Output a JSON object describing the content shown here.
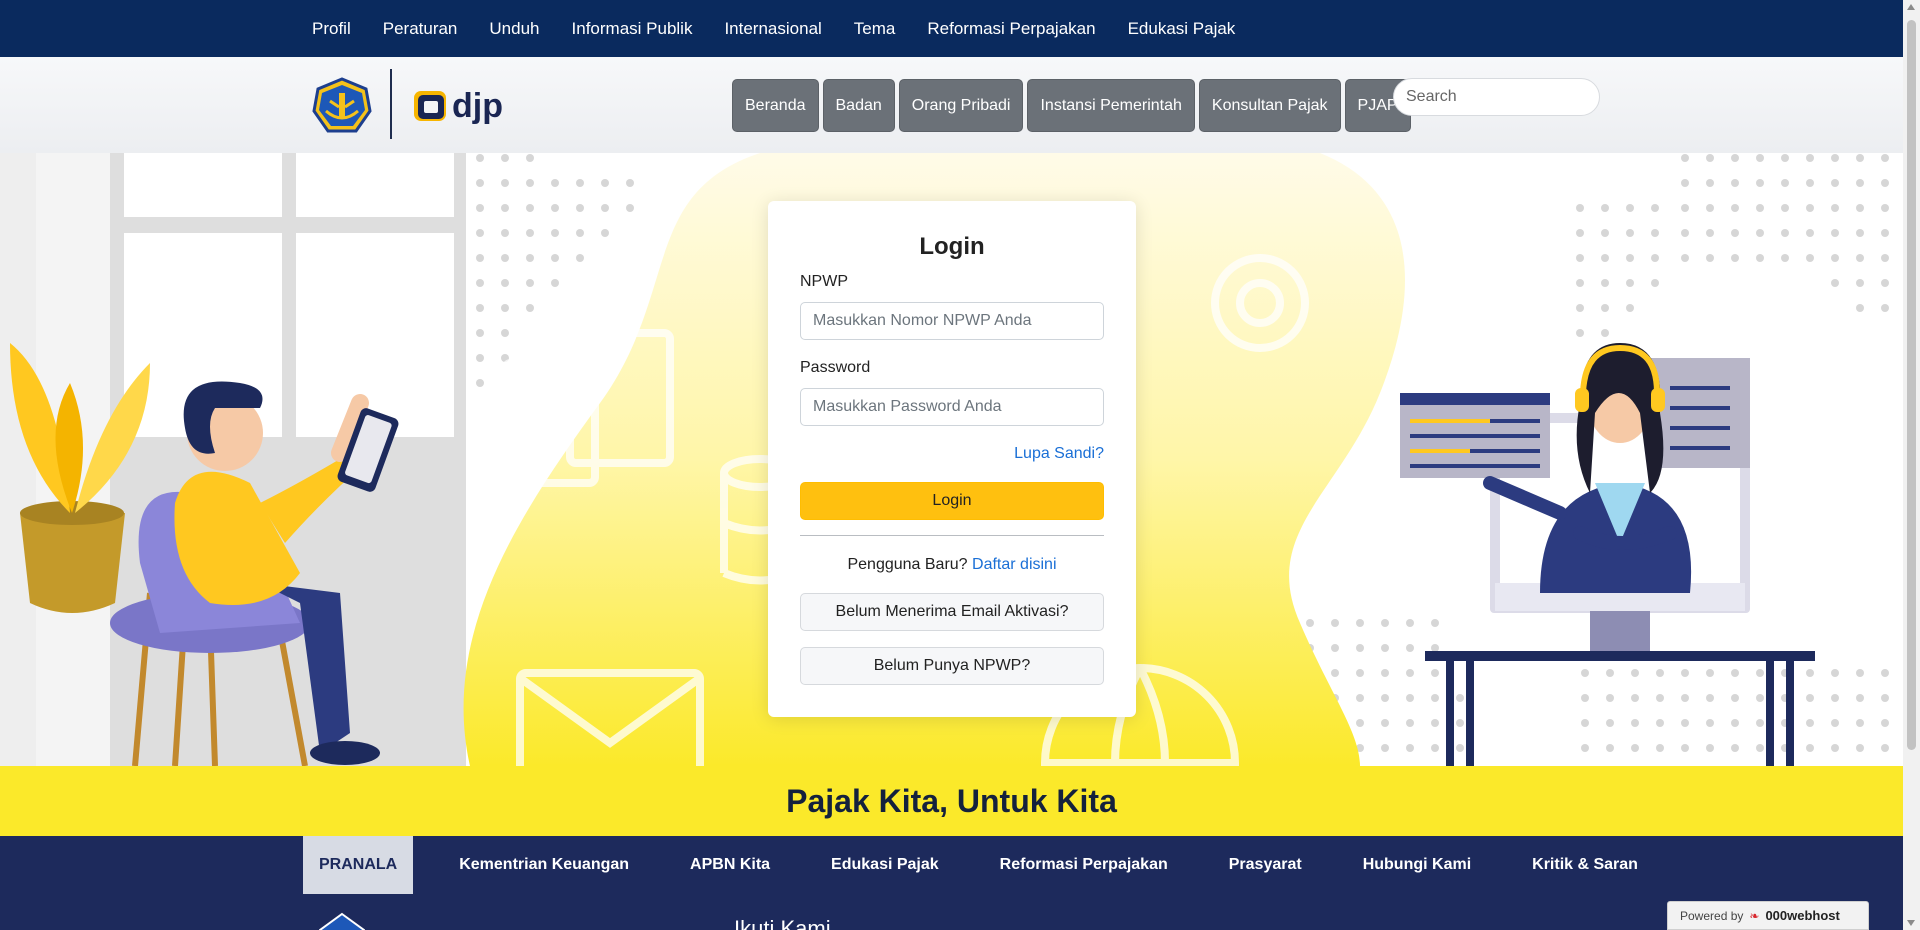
{
  "topnav": {
    "items": [
      "Profil",
      "Peraturan",
      "Unduh",
      "Informasi Publik",
      "Internasional",
      "Tema",
      "Reformasi Perpajakan",
      "Edukasi Pajak"
    ]
  },
  "header": {
    "logo_text": "djp",
    "nav": [
      "Beranda",
      "Badan",
      "Orang Pribadi",
      "Instansi Pemerintah",
      "Konsultan Pajak",
      "PJAP"
    ],
    "search_placeholder": "Search"
  },
  "login": {
    "title": "Login",
    "npwp_label": "NPWP",
    "npwp_placeholder": "Masukkan Nomor NPWP Anda",
    "password_label": "Password",
    "password_placeholder": "Masukkan Password Anda",
    "forgot": "Lupa Sandi?",
    "submit": "Login",
    "new_user_text": "Pengguna Baru?",
    "register_link": "Daftar disini",
    "activation_button": "Belum Menerima Email Aktivasi?",
    "no_npwp_button": "Belum Punya NPWP?"
  },
  "band": {
    "slogan": "Pajak Kita, Untuk Kita"
  },
  "footer": {
    "pranala": "PRANALA",
    "links": [
      "Kementrian Keuangan",
      "APBN Kita",
      "Edukasi Pajak",
      "Reformasi Perpajakan",
      "Prasyarat",
      "Hubungi Kami",
      "Kritik & Saran"
    ],
    "follow": "Ikuti Kami"
  },
  "powered": {
    "prefix": "Powered by",
    "brand": "000webhost"
  },
  "colors": {
    "topnav_bg": "#0a2a5e",
    "button_gray": "#6b7178",
    "login_yellow": "#ffc00f",
    "band_yellow": "#fbe92a",
    "footer_navy": "#1d2a5c",
    "link_blue": "#1a6fd6"
  }
}
